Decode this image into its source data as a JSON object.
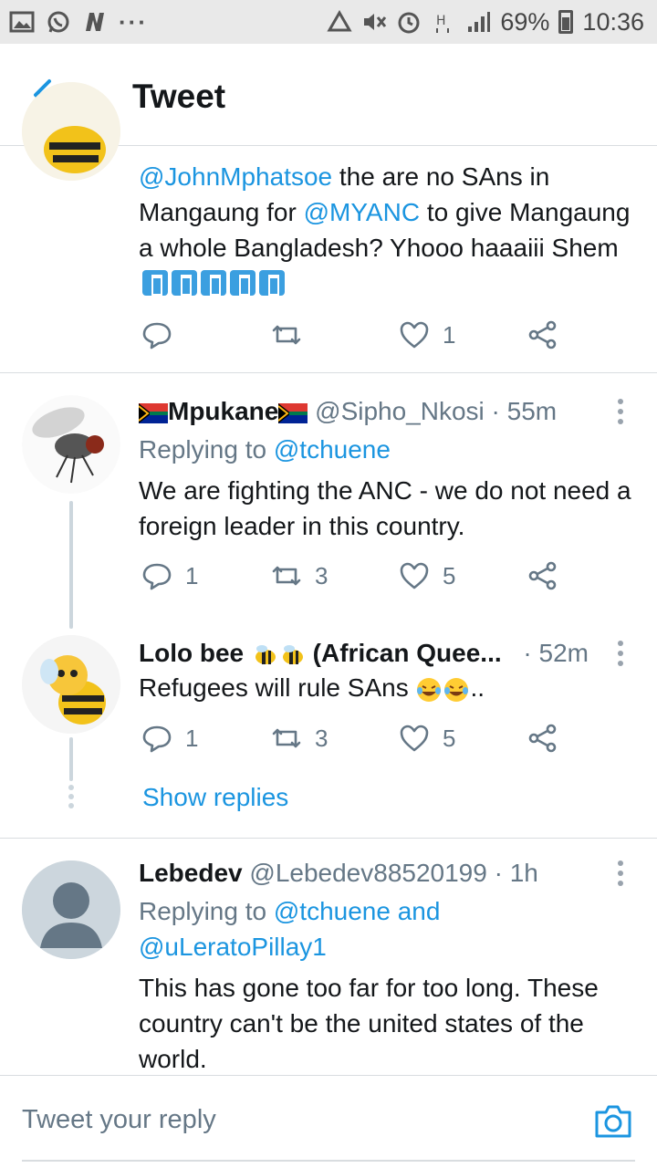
{
  "status_bar": {
    "icons_left": [
      "gallery-icon",
      "whatsapp-icon",
      "n-app-icon"
    ],
    "more": "···",
    "icons_right": [
      "recycle-icon",
      "mute-icon",
      "alarm-icon",
      "h-plus-icon",
      "signal-icon"
    ],
    "battery": "69%",
    "time": "10:36"
  },
  "header": {
    "title": "Tweet"
  },
  "tweets": [
    {
      "text_mention": "@JohnMphatsoe",
      "text_a": " the are no SAns in Mangaung for ",
      "text_mention2": "@MYANC",
      "text_b": " to give Mangaung a  whole Bangladesh? Yhooo haaaiii Shem",
      "replies": "",
      "retweets": "",
      "likes": "1"
    },
    {
      "name": "Mpukane",
      "handle": "@Sipho_Nkosi",
      "time": "· 55m",
      "replying_prefix": "Replying to ",
      "replying_to": "@tchuene",
      "text": "We are fighting the ANC - we do not need a foreign leader in this country.",
      "replies": "1",
      "retweets": "3",
      "likes": "5"
    },
    {
      "name": "Lolo bee",
      "name_suffix": " (African Quee...",
      "time": "· 52m",
      "text": "Refugees will rule SAns",
      "text_suffix": "..",
      "replies": "1",
      "retweets": "3",
      "likes": "5",
      "show_replies": "Show replies"
    },
    {
      "name": "Lebedev",
      "handle": "@Lebedev88520199",
      "time": "· 1h",
      "replying_prefix": "Replying to ",
      "replying_to": "@tchuene and",
      "replying_to2": "@uLeratoPillay1",
      "text": "This has gone too far for too long. These country can't be the united states of the world."
    }
  ],
  "reply_bar": {
    "placeholder": "Tweet your reply"
  },
  "colors": {
    "accent": "#1b95e0",
    "muted": "#657786",
    "text": "#14171a",
    "divider": "#d9dde0"
  }
}
